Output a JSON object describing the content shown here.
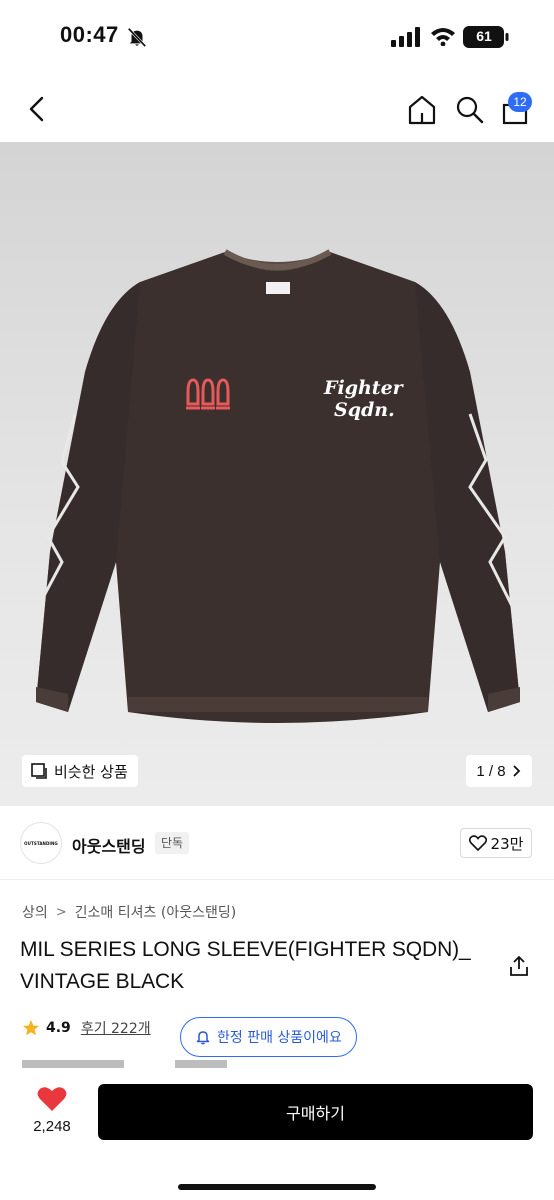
{
  "status_bar": {
    "time": "00:47",
    "battery": "61",
    "icons": [
      "bell-slash-icon",
      "signal-icon",
      "wifi-icon",
      "battery-icon"
    ]
  },
  "nav": {
    "cart_count": "12",
    "icons": [
      "back-icon",
      "home-icon",
      "search-icon",
      "cart-icon"
    ]
  },
  "gallery": {
    "similar_label": "비슷한 상품",
    "pager": "1 / 8",
    "print_text_line1": "Fighter",
    "print_text_line2": "Sqdn."
  },
  "brand": {
    "logo_text": "OUTSTANDING",
    "name": "아웃스탠딩",
    "tag": "단독",
    "likes": "23만"
  },
  "product": {
    "breadcrumb": [
      "상의",
      "긴소매 티셔츠 (아웃스탠딩)"
    ],
    "title": "MIL SERIES LONG SLEEVE(FIGHTER SQDN)_ VINTAGE BLACK",
    "rating": "4.9",
    "review_label": "후기 222개",
    "limited_label": "한정 판매 상품이에요"
  },
  "bottom_bar": {
    "wish_count": "2,248",
    "buy_label": "구매하기"
  },
  "colors": {
    "accent_blue": "#2f6cf5",
    "heart_red": "#e8383d",
    "star_yellow": "#f5b323",
    "shirt": "#3b302d"
  }
}
